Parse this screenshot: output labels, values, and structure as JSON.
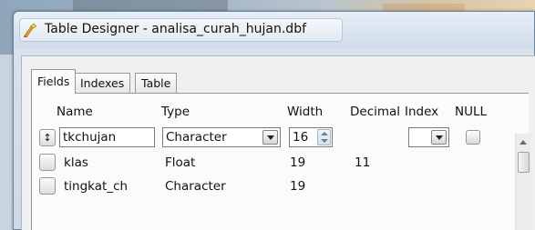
{
  "window": {
    "title": "Table Designer - analisa_curah_hujan.dbf"
  },
  "tabs": [
    {
      "label": "Fields",
      "active": true
    },
    {
      "label": "Indexes",
      "active": false
    },
    {
      "label": "Table",
      "active": false
    }
  ],
  "columns": {
    "name": "Name",
    "type": "Type",
    "width": "Width",
    "decimal": "Decimal",
    "index": "Index",
    "null": "NULL"
  },
  "rows": [
    {
      "selector": "↕",
      "name": "tkchujan",
      "type": "Character",
      "width": "16",
      "decimal": "",
      "editing": true
    },
    {
      "selector": "",
      "name": "klas",
      "type": "Float",
      "width": "19",
      "decimal": "11",
      "editing": false
    },
    {
      "selector": "",
      "name": "tingkat_ch",
      "type": "Character",
      "width": "19",
      "decimal": "",
      "editing": false
    }
  ],
  "icons": {
    "app": "table-designer-icon",
    "dropdown": "chevron-down-icon",
    "spinner": "spinner-icon",
    "scroll_up": "scroll-up-icon",
    "row_selector": "up-down-arrow-icon"
  }
}
